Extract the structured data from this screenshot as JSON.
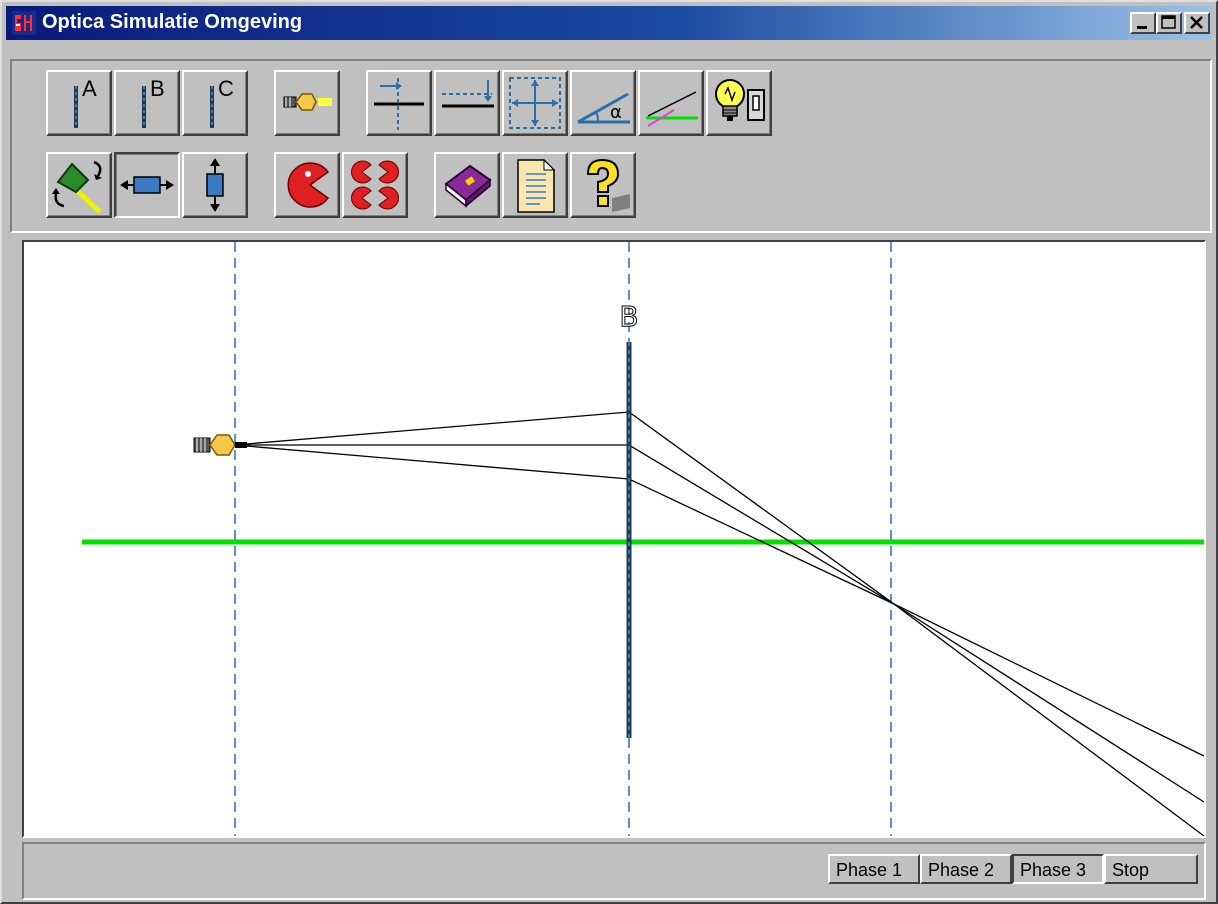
{
  "window": {
    "title": "Optica Simulatie Omgeving",
    "controls": [
      "minimize-icon",
      "maximize-icon",
      "close-icon"
    ]
  },
  "toolbar": {
    "row1": [
      {
        "name": "lens-a-button",
        "label": "A",
        "icon": "lens-icon"
      },
      {
        "name": "lens-b-button",
        "label": "B",
        "icon": "lens-icon"
      },
      {
        "name": "lens-c-button",
        "label": "C",
        "icon": "lens-icon"
      },
      {
        "name": "light-source-button",
        "icon": "lamp-icon"
      },
      {
        "name": "horizontal-distance-button",
        "icon": "horizontal-distance-icon"
      },
      {
        "name": "vertical-distance-button",
        "icon": "vertical-distance-icon"
      },
      {
        "name": "scale-button",
        "icon": "scale-icon"
      },
      {
        "name": "angle-button",
        "icon": "angle-icon",
        "label": "α"
      },
      {
        "name": "ray-angle-button",
        "icon": "ray-icon"
      },
      {
        "name": "light-switch-button",
        "icon": "lightbulb-switch-icon"
      }
    ],
    "row2": [
      {
        "name": "rotate-button",
        "icon": "rotate-pin-icon"
      },
      {
        "name": "move-horizontal-button",
        "icon": "move-horizontal-icon",
        "pressed": true
      },
      {
        "name": "move-vertical-button",
        "icon": "move-vertical-icon"
      },
      {
        "name": "delete-button",
        "icon": "pacman-icon"
      },
      {
        "name": "delete-all-button",
        "icon": "pacman-group-icon"
      },
      {
        "name": "book-button",
        "icon": "book-icon"
      },
      {
        "name": "document-button",
        "icon": "document-icon"
      },
      {
        "name": "help-button",
        "icon": "question-mark-icon"
      }
    ]
  },
  "canvas": {
    "lens_label": "B",
    "colors": {
      "guide": "#2a6fa8",
      "axis": "#00e000",
      "ray": "#000000",
      "lens": "#1a3a5a"
    }
  },
  "statusbar": {
    "buttons": [
      {
        "label": "Phase 1",
        "active": false
      },
      {
        "label": "Phase 2",
        "active": false
      },
      {
        "label": "Phase 3",
        "active": true
      },
      {
        "label": "Stop",
        "active": false
      }
    ]
  }
}
